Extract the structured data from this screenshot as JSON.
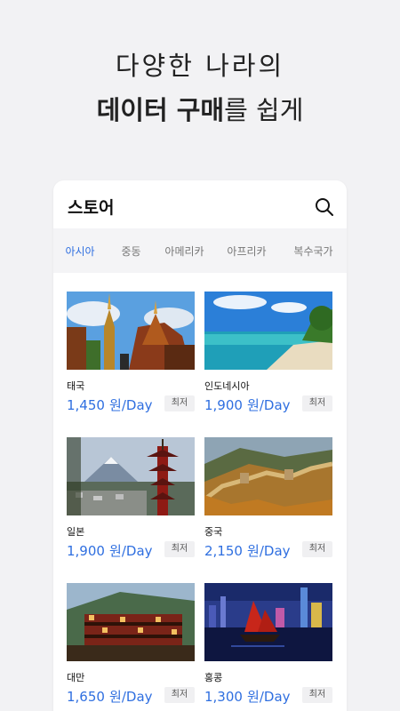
{
  "hero": {
    "line1": "다양한 나라의",
    "line2_bold": "데이터 구매",
    "line2_rest": "를 쉽게"
  },
  "store": {
    "title": "스토어",
    "search_icon": "search-icon",
    "tabs": [
      "아시아",
      "중동",
      "아메리카",
      "아프리카",
      "복수국가"
    ],
    "active_tab": "아시아"
  },
  "items": [
    {
      "country": "태국",
      "price": "1,450",
      "unit": "원/Day",
      "badge": "최저"
    },
    {
      "country": "인도네시아",
      "price": "1,900",
      "unit": "원/Day",
      "badge": "최저"
    },
    {
      "country": "일본",
      "price": "1,900",
      "unit": "원/Day",
      "badge": "최저"
    },
    {
      "country": "중국",
      "price": "2,150",
      "unit": "원/Day",
      "badge": "최저"
    },
    {
      "country": "대만",
      "price": "1,650",
      "unit": "원/Day",
      "badge": "최저"
    },
    {
      "country": "홍콩",
      "price": "1,300",
      "unit": "원/Day",
      "badge": "최저"
    }
  ],
  "colors": {
    "accent": "#2f6fe0",
    "background": "#f2f2f4"
  }
}
